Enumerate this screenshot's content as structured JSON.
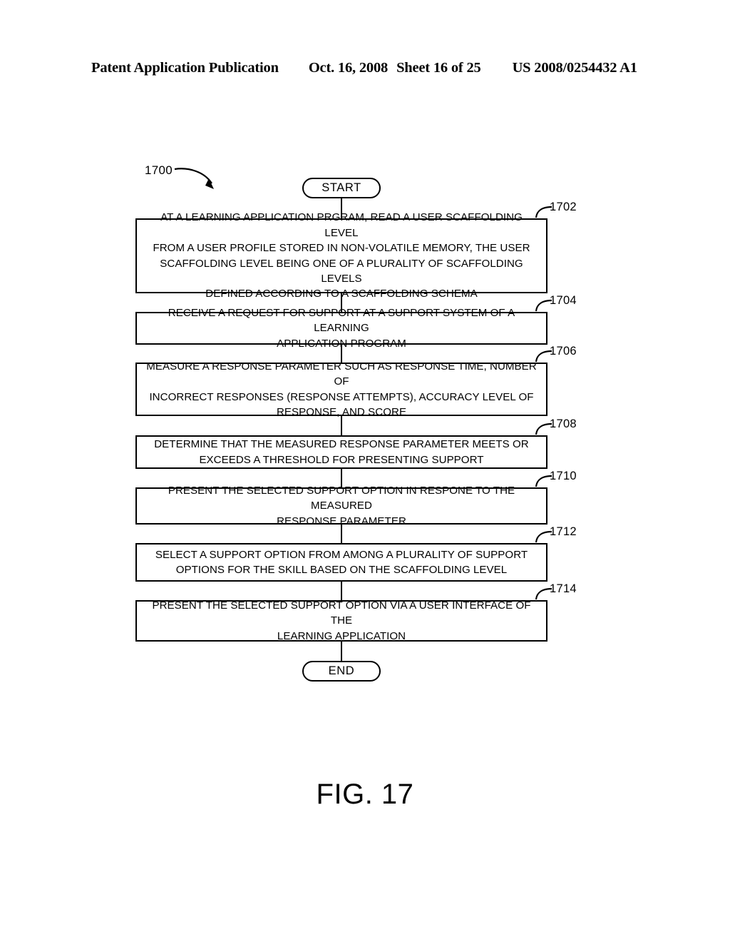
{
  "header": {
    "left": "Patent Application Publication",
    "date": "Oct. 16, 2008",
    "sheet": "Sheet 16 of 25",
    "pubnumber": "US 2008/0254432 A1"
  },
  "figure": {
    "id_label": "1700",
    "caption": "FIG. 17"
  },
  "flowchart": {
    "start_label": "START",
    "end_label": "END",
    "steps": [
      {
        "ref": "1702",
        "text": "AT A LEARNING APPLICATION PRGRAM, READ A USER SCAFFOLDING LEVEL\nFROM A USER PROFILE STORED IN NON-VOLATILE MEMORY, THE USER\nSCAFFOLDING LEVEL BEING ONE OF A PLURALITY OF SCAFFOLDING LEVELS\nDEFINED ACCORDING TO A SCAFFOLDING SCHEMA"
      },
      {
        "ref": "1704",
        "text": "RECEIVE A REQUEST FOR SUPPORT AT A SUPPORT SYSTEM OF A LEARNING\nAPPLICATION PROGRAM"
      },
      {
        "ref": "1706",
        "text": "MEASURE A RESPONSE PARAMETER SUCH AS RESPONSE TIME, NUMBER OF\nINCORRECT RESPONSES (RESPONSE ATTEMPTS), ACCURACY LEVEL OF\nRESPONSE, AND SCORE"
      },
      {
        "ref": "1708",
        "text": "DETERMINE THAT THE MEASURED RESPONSE PARAMETER MEETS OR\nEXCEEDS A THRESHOLD FOR PRESENTING SUPPORT"
      },
      {
        "ref": "1710",
        "text": "PRESENT THE SELECTED SUPPORT OPTION IN RESPONE TO THE MEASURED\nRESPONSE PARAMETER"
      },
      {
        "ref": "1712",
        "text": "SELECT A SUPPORT OPTION FROM AMONG A PLURALITY OF SUPPORT\nOPTIONS FOR THE SKILL BASED ON THE SCAFFOLDING LEVEL"
      },
      {
        "ref": "1714",
        "text": "PRESENT THE SELECTED SUPPORT OPTION VIA A USER INTERFACE OF THE\nLEARNING APPLICATION"
      }
    ]
  },
  "colors": {
    "ink": "#000000",
    "paper": "#ffffff"
  }
}
